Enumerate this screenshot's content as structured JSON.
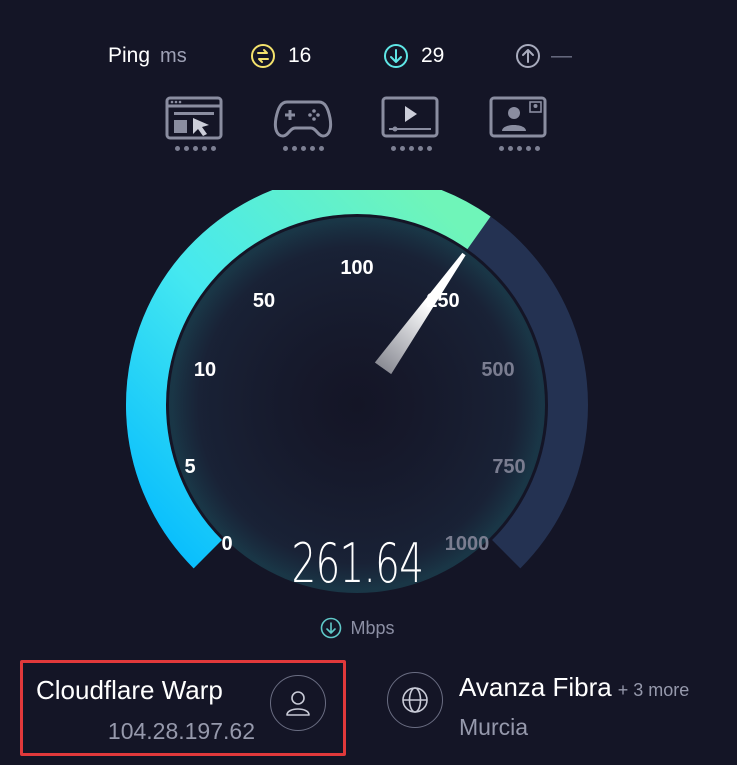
{
  "ping": {
    "label": "Ping",
    "unit": "ms",
    "latency": "16",
    "download": "29",
    "upload": "—",
    "latency_icon": "idle-latency-icon",
    "download_icon": "download-arrow-icon",
    "upload_icon": "upload-arrow-icon"
  },
  "use_cases": [
    {
      "icon": "web-browsing-icon",
      "rating": 0
    },
    {
      "icon": "gamepad-icon",
      "rating": 0
    },
    {
      "icon": "video-streaming-icon",
      "rating": 0
    },
    {
      "icon": "video-chat-icon",
      "rating": 0
    }
  ],
  "gauge": {
    "ticks": [
      "0",
      "5",
      "10",
      "50",
      "100",
      "250",
      "500",
      "750",
      "1000"
    ],
    "max": 1000,
    "needle_value": 261.64,
    "colors": {
      "start": "#00b8ff",
      "mid": "#56f0e0",
      "end": "#6ff5b9",
      "track": "#243252"
    }
  },
  "result": {
    "speed": "261.64",
    "unit": "Mbps"
  },
  "provider": {
    "name": "Cloudflare Warp",
    "ip": "104.28.197.62",
    "icon": "user-icon"
  },
  "server": {
    "name": "Avanza Fibra",
    "more": "+ 3 more",
    "location": "Murcia",
    "icon": "globe-icon"
  }
}
